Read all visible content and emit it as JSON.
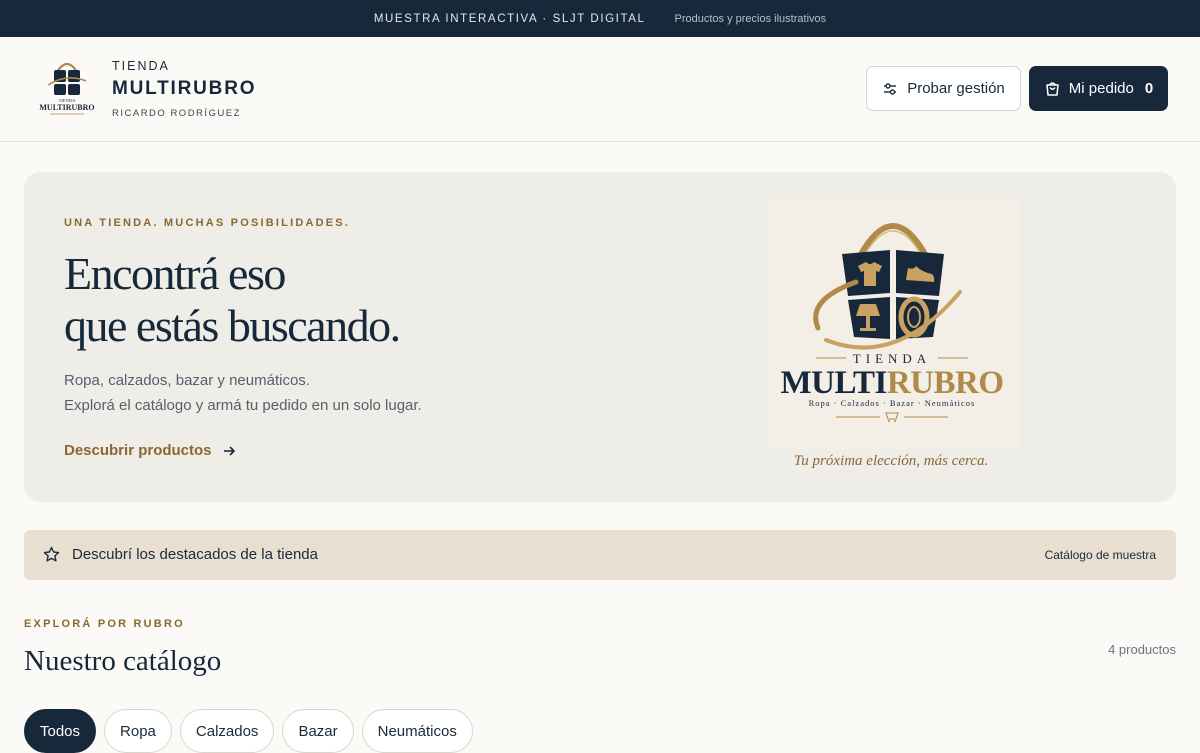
{
  "topbar": {
    "label": "MUESTRA INTERACTIVA · SLJT DIGITAL",
    "note": "Productos y precios ilustrativos"
  },
  "header": {
    "brand_pre": "TIENDA",
    "brand_name": "MULTIRUBRO",
    "brand_owner": "RICARDO RODRÍGUEZ",
    "manage_button": "Probar gestión",
    "order_button": "Mi pedido",
    "order_count": "0"
  },
  "hero": {
    "eyebrow": "UNA TIENDA. MUCHAS POSIBILIDADES.",
    "title_line1": "Encontrá eso",
    "title_line2": "que estás buscando.",
    "desc_line1": "Ropa, calzados, bazar y neumáticos.",
    "desc_line2": "Explorá el catálogo y armá tu pedido en un solo lugar.",
    "cta": "Descubrir productos",
    "tagline": "Tu próxima elección, más cerca."
  },
  "logo": {
    "pre": "TIENDA",
    "name_a": "MULTI",
    "name_b": "RUBRO",
    "rubros": "Ropa · Calzados · Bazar · Neumáticos",
    "small_pre": "TIENDA",
    "small_name": "MULTIRUBRO"
  },
  "featured": {
    "text": "Descubrí los destacados de la tienda",
    "right": "Catálogo de muestra"
  },
  "catalog": {
    "eyebrow": "EXPLORÁ POR RUBRO",
    "title": "Nuestro catálogo",
    "count": "4 productos",
    "chips": [
      {
        "label": "Todos"
      },
      {
        "label": "Ropa"
      },
      {
        "label": "Calzados"
      },
      {
        "label": "Bazar"
      },
      {
        "label": "Neumáticos"
      }
    ]
  },
  "colors": {
    "navy": "#17283a",
    "gold": "#8b6731",
    "hero_bg": "#efede8",
    "banner_bg": "#e8dfd1"
  },
  "icons": [
    "sliders-icon",
    "shopping-bag-icon",
    "arrow-right-icon",
    "star-icon"
  ]
}
